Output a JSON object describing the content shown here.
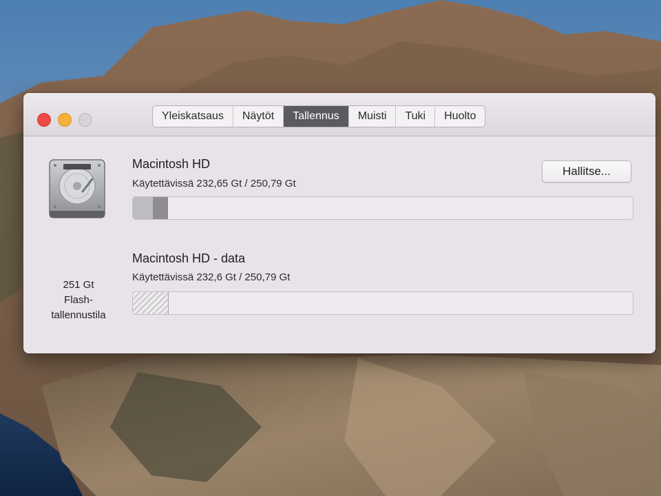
{
  "window": {
    "tabs": [
      {
        "label": "Yleiskatsaus",
        "active": false
      },
      {
        "label": "Näytöt",
        "active": false
      },
      {
        "label": "Tallennus",
        "active": true
      },
      {
        "label": "Muisti",
        "active": false
      },
      {
        "label": "Tuki",
        "active": false
      },
      {
        "label": "Huolto",
        "active": false
      }
    ]
  },
  "drive": {
    "icon": "hard-drive-icon",
    "size_label": "251 Gt",
    "type_line1": "Flash-",
    "type_line2": "tallennustila"
  },
  "volumes": [
    {
      "name": "Macintosh HD",
      "availability": "Käytettävissä 232,65 Gt / 250,79 Gt",
      "manage_button": "Hallitse...",
      "used_fraction": 0.07,
      "segments": [
        {
          "kind": "system",
          "fraction": 0.04,
          "color": "#bdbcbf"
        },
        {
          "kind": "other",
          "fraction": 0.03,
          "color": "#8f8c92"
        }
      ]
    },
    {
      "name": "Macintosh HD - data",
      "availability": "Käytettävissä 232,6 Gt / 250,79 Gt",
      "used_fraction": 0.07,
      "segments": [
        {
          "kind": "hatched",
          "fraction": 0.07,
          "color": "#d3d0d4"
        }
      ]
    }
  ],
  "colors": {
    "close": "#ee4b45",
    "minimize": "#f3b13a",
    "zoom": "#d8d3d8",
    "active_tab": "#5b5a60"
  }
}
